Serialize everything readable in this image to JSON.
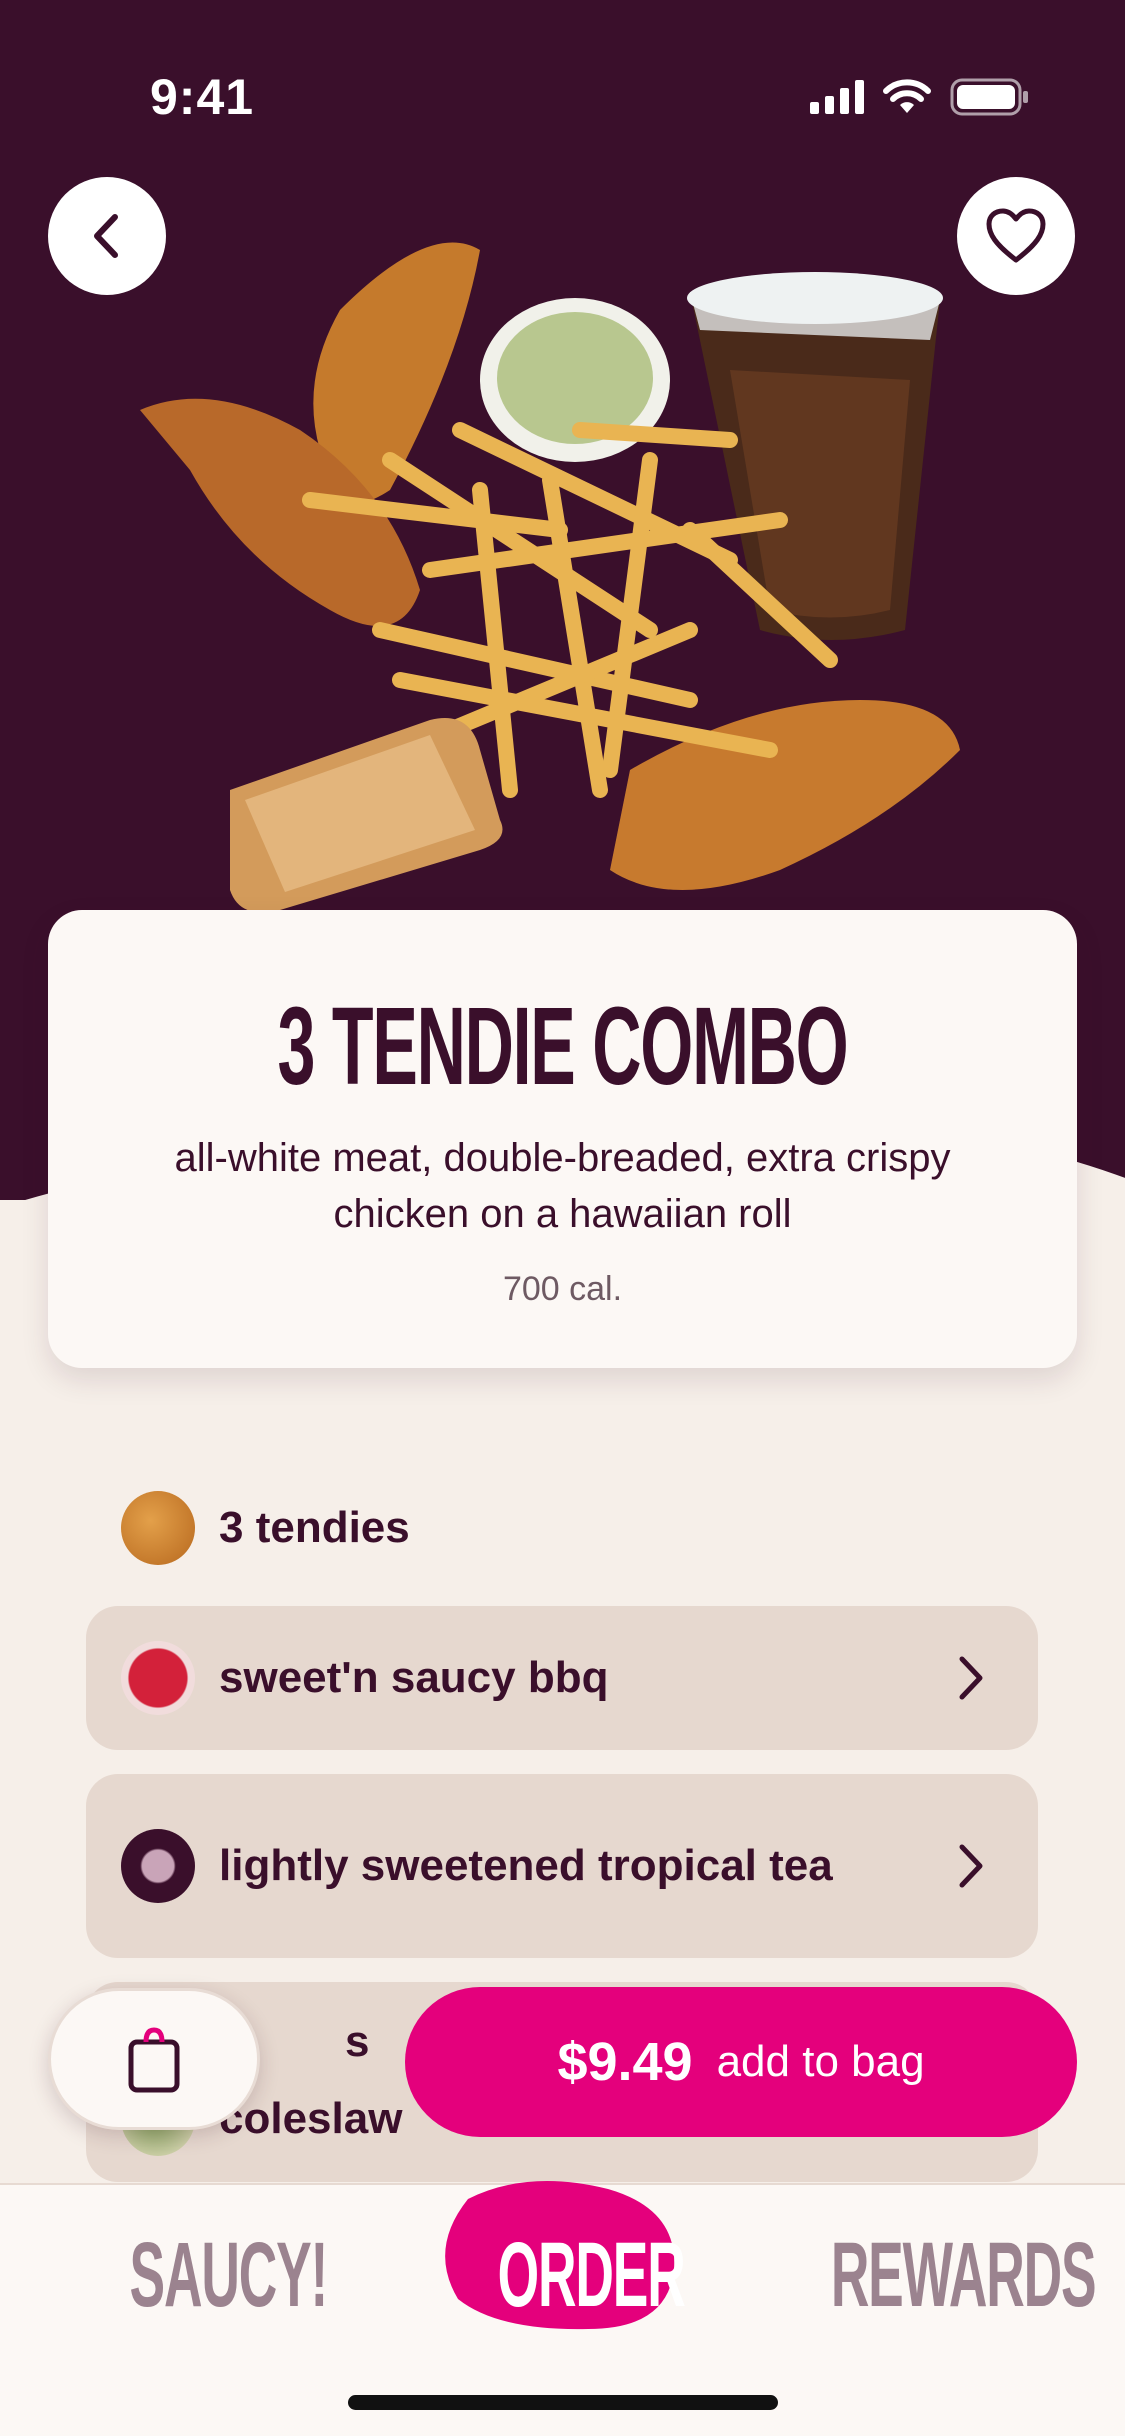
{
  "status": {
    "time": "9:41"
  },
  "nav": {
    "back_icon": "chevron-left-icon",
    "favorite_icon": "heart-icon"
  },
  "product": {
    "title": "3 TENDIE COMBO",
    "description": "all-white meat, double-breaded, extra crispy chicken on a hawaiian roll",
    "calories": "700 cal."
  },
  "items": [
    {
      "label": "3 tendies",
      "selectable": false
    },
    {
      "label": "sweet'n saucy bbq",
      "selectable": true
    },
    {
      "label": "lightly sweetened tropical tea",
      "selectable": true
    },
    {
      "label": "s",
      "selectable": true
    },
    {
      "label": "coleslaw",
      "selectable": false
    }
  ],
  "cart": {
    "icon": "shopping-bag-icon",
    "price": "$9.49",
    "add_label": "add to bag"
  },
  "tabs": [
    {
      "label": "SAUCY!"
    },
    {
      "label": "ORDER",
      "active": true
    },
    {
      "label": "REWARDS"
    }
  ],
  "colors": {
    "brand_dark": "#3a0f2b",
    "accent": "#e4007c",
    "cream": "#f6efe9"
  }
}
